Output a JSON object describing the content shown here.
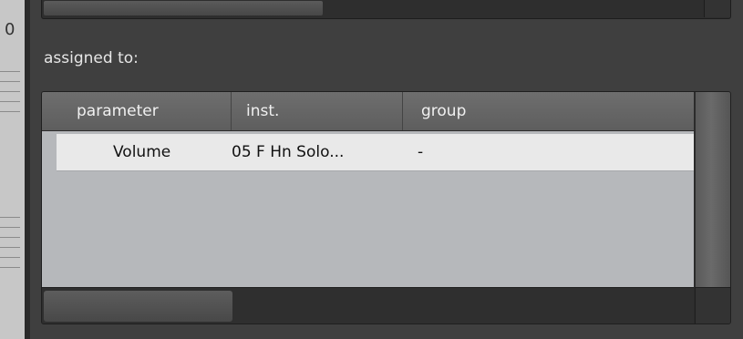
{
  "left_ruler": {
    "glyph": "0"
  },
  "assigned": {
    "label": "assigned to:"
  },
  "table": {
    "columns": [
      "parameter",
      "inst.",
      "group"
    ],
    "rows": [
      {
        "parameter": "Volume",
        "inst": "05 F Hn Solo...",
        "group": "-"
      }
    ]
  },
  "colors": {
    "panel": "#3f3f3f",
    "header": "#666666",
    "row_selected": "#e9e9e9",
    "list_background": "#b6b8bb"
  }
}
